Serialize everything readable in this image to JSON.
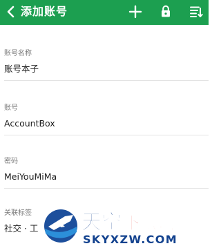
{
  "header": {
    "title": "添加账号",
    "back_icon": "back-arrow-icon",
    "actions": [
      "add-icon",
      "lock-icon",
      "sort-list-icon"
    ],
    "color": "#1c9f50"
  },
  "fields": [
    {
      "label": "账号名称",
      "value": "账号本子"
    },
    {
      "label": "账号",
      "value": "AccountBox"
    },
    {
      "label": "密码",
      "value": "MeiYouMiMa"
    },
    {
      "label": "关联标签",
      "value": "社交 · 工"
    }
  ],
  "watermark": {
    "brand_cn": "天空下载玩",
    "brand_en": "SKYXZW.COM"
  }
}
